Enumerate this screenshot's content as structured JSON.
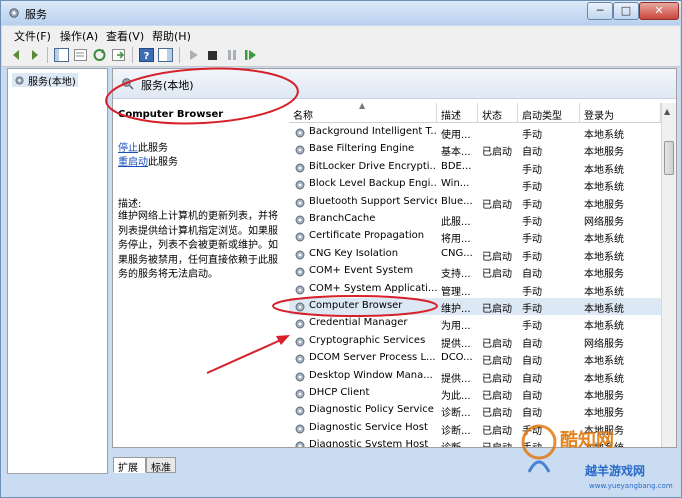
{
  "window": {
    "title": "服务",
    "min": "─",
    "max": "□",
    "close": "✕"
  },
  "menu": [
    "文件(F)",
    "操作(A)",
    "查看(V)",
    "帮助(H)"
  ],
  "tree": {
    "item": "服务(本地)"
  },
  "panel": {
    "header": "服务(本地)",
    "selected_service": "Computer Browser",
    "links": [
      {
        "link": "停止",
        "rest": "此服务"
      },
      {
        "link": "重启动",
        "rest": "此服务"
      }
    ],
    "desc_label": "描述:",
    "desc_body": "维护网络上计算机的更新列表，并将列表提供给计算机指定浏览。如果服务停止，列表不会被更新或维护。如果服务被禁用，任何直接依赖于此服务的服务将无法启动。"
  },
  "table": {
    "columns": [
      "名称",
      "描述",
      "状态",
      "启动类型",
      "登录为"
    ],
    "rows": [
      {
        "name": "Background Intelligent T...",
        "desc": "使用...",
        "status": "",
        "startup": "手动",
        "logon": "本地系统"
      },
      {
        "name": "Base Filtering Engine",
        "desc": "基本...",
        "status": "已启动",
        "startup": "自动",
        "logon": "本地服务"
      },
      {
        "name": "BitLocker Drive Encrypti...",
        "desc": "BDE...",
        "status": "",
        "startup": "手动",
        "logon": "本地系统"
      },
      {
        "name": "Block Level Backup Engi...",
        "desc": "Win...",
        "status": "",
        "startup": "手动",
        "logon": "本地系统"
      },
      {
        "name": "Bluetooth Support Service",
        "desc": "Blue...",
        "status": "已启动",
        "startup": "手动",
        "logon": "本地服务"
      },
      {
        "name": "BranchCache",
        "desc": "此服...",
        "status": "",
        "startup": "手动",
        "logon": "网络服务"
      },
      {
        "name": "Certificate Propagation",
        "desc": "将用...",
        "status": "",
        "startup": "手动",
        "logon": "本地系统"
      },
      {
        "name": "CNG Key Isolation",
        "desc": "CNG...",
        "status": "已启动",
        "startup": "手动",
        "logon": "本地系统"
      },
      {
        "name": "COM+ Event System",
        "desc": "支持...",
        "status": "已启动",
        "startup": "自动",
        "logon": "本地服务"
      },
      {
        "name": "COM+ System Applicati...",
        "desc": "管理...",
        "status": "",
        "startup": "手动",
        "logon": "本地系统"
      },
      {
        "name": "Computer Browser",
        "desc": "维护...",
        "status": "已启动",
        "startup": "手动",
        "logon": "本地系统",
        "selected": true
      },
      {
        "name": "Credential Manager",
        "desc": "为用...",
        "status": "",
        "startup": "手动",
        "logon": "本地系统"
      },
      {
        "name": "Cryptographic Services",
        "desc": "提供...",
        "status": "已启动",
        "startup": "自动",
        "logon": "网络服务"
      },
      {
        "name": "DCOM Server Process L...",
        "desc": "DCO...",
        "status": "已启动",
        "startup": "自动",
        "logon": "本地系统"
      },
      {
        "name": "Desktop Window Mana...",
        "desc": "提供...",
        "status": "已启动",
        "startup": "自动",
        "logon": "本地系统"
      },
      {
        "name": "DHCP Client",
        "desc": "为此...",
        "status": "已启动",
        "startup": "自动",
        "logon": "本地服务"
      },
      {
        "name": "Diagnostic Policy Service",
        "desc": "诊断...",
        "status": "已启动",
        "startup": "自动",
        "logon": "本地服务"
      },
      {
        "name": "Diagnostic Service Host",
        "desc": "诊断...",
        "status": "已启动",
        "startup": "手动",
        "logon": "本地服务"
      },
      {
        "name": "Diagnostic System Host",
        "desc": "诊断...",
        "status": "已启动",
        "startup": "手动",
        "logon": "本地系统"
      }
    ]
  },
  "tabs": [
    "扩展",
    "标准"
  ],
  "watermark": {
    "brand": "酷知网",
    "slogan": "越羊游戏网",
    "url": "www.yueyangbang.com"
  },
  "colors": {
    "annotation": "#d6202a",
    "selection": "#dde8f5",
    "link": "#1a4fba"
  }
}
